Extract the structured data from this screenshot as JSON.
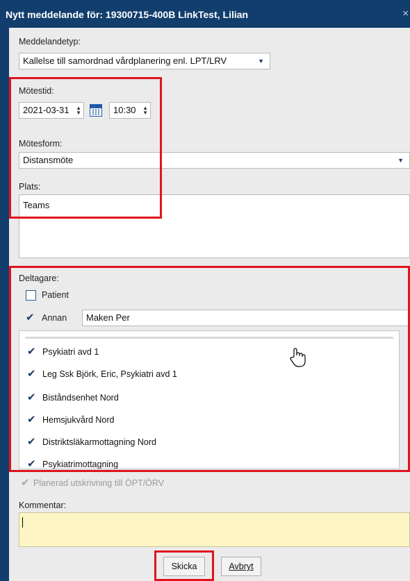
{
  "window": {
    "title": "Nytt meddelande för: 19300715-400B LinkTest, Lilian",
    "close_glyph": "×"
  },
  "message_type": {
    "label": "Meddelandetyp:",
    "value": "Kallelse till samordnad vårdplanering enl. LPT/LRV"
  },
  "meeting_time": {
    "label": "Mötestid:",
    "date": "2021-03-31",
    "time": "10:30"
  },
  "meeting_form": {
    "label": "Mötesform:",
    "value": "Distansmöte"
  },
  "place": {
    "label": "Plats:",
    "value": "Teams"
  },
  "participants": {
    "label": "Deltagare:",
    "patient_label": "Patient",
    "patient_checked": false,
    "other_label": "Annan",
    "other_checked": true,
    "other_value": "Maken Per",
    "items": [
      {
        "label": "Psykiatri avd 1",
        "checked": true
      },
      {
        "label": "Leg Ssk Björk, Eric, Psykiatri avd 1",
        "checked": true
      },
      {
        "label": "Biståndsenhet Nord",
        "checked": true
      },
      {
        "label": "Hemsjukvård Nord",
        "checked": true
      },
      {
        "label": "Distriktsläkarmottagning Nord",
        "checked": true
      },
      {
        "label": "Psykiatrimottagning",
        "checked": true
      }
    ]
  },
  "planned_discharge": {
    "label": "Planerad utskrivning till ÖPT/ÖRV",
    "checked": true,
    "enabled": false
  },
  "comment": {
    "label": "Kommentar:",
    "value": ""
  },
  "buttons": {
    "send": "Skicka",
    "cancel": "Avbryt"
  },
  "colors": {
    "titlebar": "#123e6d",
    "highlight": "#e0141e",
    "comment_bg": "#fdf6c4"
  }
}
